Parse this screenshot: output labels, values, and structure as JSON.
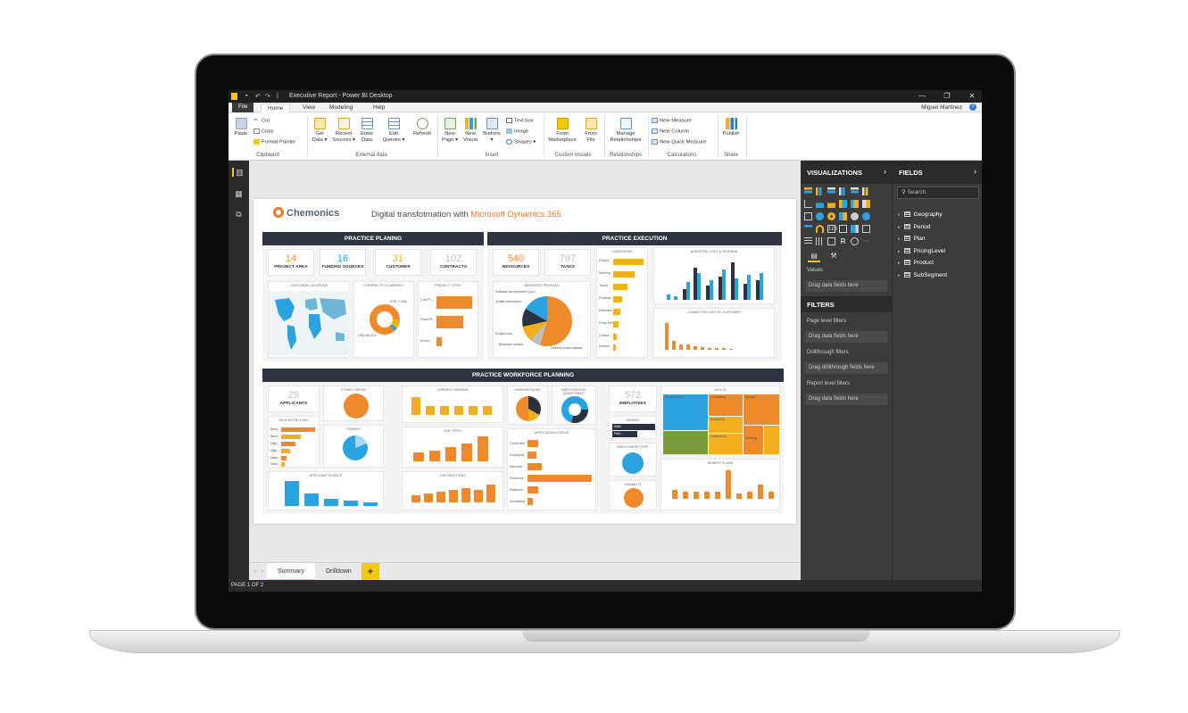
{
  "window": {
    "title": "Executive Report - Power BI Desktop",
    "minimize": "—",
    "restore": "❐",
    "close": "✕"
  },
  "menu": {
    "tabs": [
      "File",
      "Home",
      "View",
      "Modeling",
      "Help"
    ],
    "user": "Miguel Martinez",
    "help_icon": "?"
  },
  "ribbon": {
    "paste": "Paste",
    "cut": "Cut",
    "copy": "Copy",
    "format_painter": "Format Painter",
    "get_data": [
      "Get",
      "Data ▾"
    ],
    "recent_sources": [
      "Recent",
      "Sources ▾"
    ],
    "enter_data": [
      "Enter",
      "Data"
    ],
    "edit_queries": [
      "Edit",
      "Queries ▾"
    ],
    "refresh": "Refresh",
    "new_page": [
      "New",
      "Page ▾"
    ],
    "new_visual": [
      "New",
      "Visual"
    ],
    "buttons": [
      "Buttons",
      "▾"
    ],
    "text_box": "Text box",
    "image": "Image",
    "shapes": "Shapes ▾",
    "from_marketplace": [
      "From",
      "Marketplace"
    ],
    "from_file": [
      "From",
      "File"
    ],
    "manage_relationships": [
      "Manage",
      "Relationships"
    ],
    "new_measure": "New Measure",
    "new_column": "New Column",
    "new_quick_measure": "New Quick Measure",
    "publish": "Publish",
    "groups": {
      "clipboard": "Clipboard",
      "external_data": "External data",
      "insert": "Insert",
      "custom_visuals": "Custom visuals",
      "relationships": "Relationships",
      "calculations": "Calculations",
      "share": "Share"
    }
  },
  "report": {
    "logo": "Chemonics",
    "title_prefix": "Digital transfotmation with ",
    "title_brand": "Microsoft Dynamics 365",
    "practice_planing": {
      "band": "PRACTICE PLANING",
      "kpis": [
        {
          "value": "14",
          "label": "PROJECT AREA",
          "color": "#ef8a2c"
        },
        {
          "value": "16",
          "label": "FUNDING SOURCES",
          "color": "#2aa3e0"
        },
        {
          "value": "31",
          "label": "CUSTOMER",
          "color": "#f2b01e"
        },
        {
          "value": "102",
          "label": "CONTRACTS",
          "color": "#bdbdbd"
        }
      ],
      "map_caption": "CUSTOMER LOCATIONS",
      "donut_caption": "CONTRACTS / CURRENCY",
      "donut_labels": [
        "EUR 7.33%",
        "USD 86.21%"
      ],
      "bars_caption": "PROJECT TYPES",
      "bars_labels": [
        "Cost Pl...",
        "Fixed Pr...",
        "Econo..."
      ]
    },
    "practice_execution": {
      "band": "PRACTICE EXECUTION",
      "kpis": [
        {
          "value": "540",
          "label": "RESOURCES",
          "color": "#ef8a2c"
        },
        {
          "value": "797",
          "label": "TASKS",
          "color": "#bdbdbd"
        }
      ],
      "pie_caption": "RESOURCE PROFILES",
      "pie_labels": [
        "Software development (con...",
        "Quality assurance...",
        "Project man...",
        "Business analyst",
        "Delivery project leader..."
      ],
      "categories_caption": "CATEGORIES",
      "categories_labels": [
        "Project",
        "Meeting",
        "Travel",
        "Pruebas",
        "Estimado",
        "Fixed Fee",
        "Consul...",
        "Indirect..."
      ],
      "budget_caption": "BUDGETED COST & REVENUE",
      "committed_caption": "COMMITTED COST BY CUSTOMER"
    },
    "workforce": {
      "band": "PRACTICE WORKFORCE PLANNING",
      "applicants_value": "25",
      "applicants_label": "APPLICANTS",
      "ethnic_caption": "ETHNIC ORIGIN",
      "education_caption": "EDUCATION LEVEL",
      "education_labels": [
        "Bach...",
        "Bach...",
        "High...",
        "High...",
        "Mast...",
        "Mast..."
      ],
      "gender_caption": "GENDER",
      "applicant_source_caption": "APPLICANT SOURCE",
      "current_opening_caption": "CURRENT OPENING",
      "job_types_caption": "JOB TYPES",
      "job_functions_caption": "JOB FUNCTIONS",
      "working_mode_caption": "WORKING MODE",
      "employees_dept_caption": "EMPLOYEES BY DEPARTMENT",
      "application_status_caption": "APPLICATION STATUS",
      "application_status_labels": [
        "Confirmed",
        "Employed",
        "Interview",
        "Received",
        "Rejection",
        "Shortlisted"
      ],
      "employees_value": "572",
      "employees_label": "EMPLOYEES",
      "gender2_caption": "GENDER",
      "gender2_labels": [
        "Male",
        "Fem..."
      ],
      "employment_type_caption": "EMPLOYMENT TYPE",
      "disability_caption": "DISABILITY",
      "skills_caption": "SKILLS",
      "skills_labels": [
        "ProjectMgmt",
        "Consulting",
        "Quality",
        "Budgeting",
        "Marketing",
        "Leadership",
        "Strategy"
      ],
      "benefit_caption": "BENEFIT PLANS"
    }
  },
  "pages": {
    "tabs": [
      "Summary",
      "Drilldown"
    ],
    "add": "+",
    "status": "PAGE 1 OF 2"
  },
  "visualizations": {
    "title": "VISUALIZATIONS",
    "chevron": "›",
    "values_label": "Values",
    "drag_fields": "Drag data fields here"
  },
  "filters": {
    "title": "FILTERS",
    "page_level": "Page level filters",
    "drag_page": "Drag data fields here",
    "drillthrough": "Drillthrough filters",
    "drag_drillthrough": "Drag drillthrough fields here",
    "report_level": "Report level filters",
    "drag_report": "Drag data fields here"
  },
  "fields": {
    "title": "FIELDS",
    "chevron": "›",
    "search_placeholder": "Search",
    "tables": [
      "Geography",
      "Period",
      "Plan",
      "PricingLevel",
      "Product",
      "SubSegment"
    ]
  },
  "colors": {
    "accent_yellow": "#f2c811",
    "orange": "#ef8a2c",
    "blue": "#2aa3e0",
    "dark": "#2f3540"
  }
}
